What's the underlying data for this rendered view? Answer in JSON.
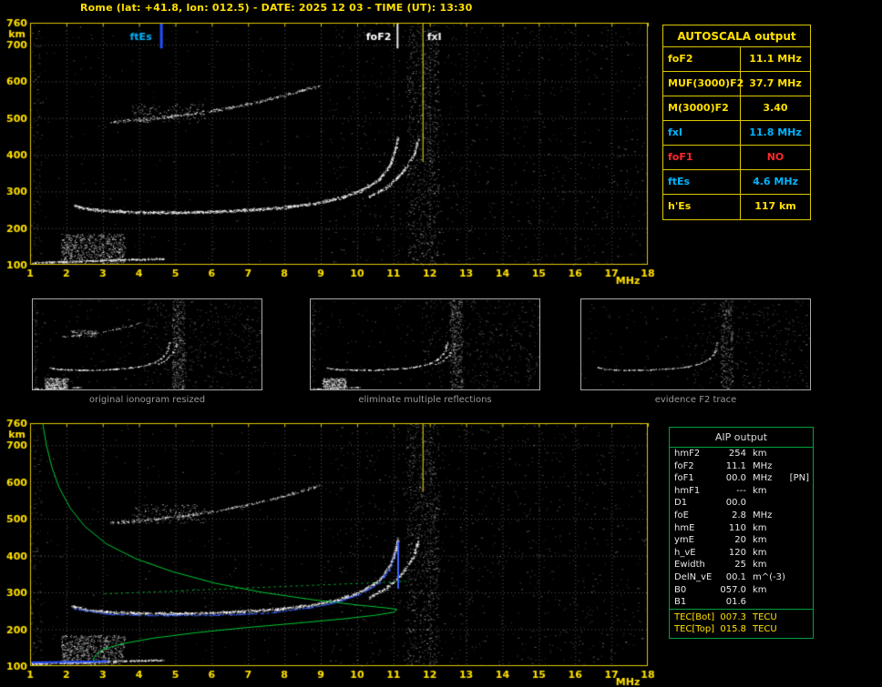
{
  "header": {
    "title": "Rome (lat: +41.8, lon: 012.5) - DATE: 2025 12 03 - TIME (UT): 13:30"
  },
  "autoscala_table": {
    "title": "AUTOSCALA output",
    "rows": [
      {
        "label": "foF2",
        "value": "11.1 MHz",
        "color": "#ffe000"
      },
      {
        "label": "MUF(3000)F2",
        "value": "37.7 MHz",
        "color": "#ffe000"
      },
      {
        "label": "M(3000)F2",
        "value": "3.40",
        "color": "#ffe000"
      },
      {
        "label": "fxI",
        "value": "11.8 MHz",
        "color": "#00b4ff"
      },
      {
        "label": "foF1",
        "value": "NO",
        "color": "#ff2828"
      },
      {
        "label": "ftEs",
        "value": "4.6 MHz",
        "color": "#00b4ff"
      },
      {
        "label": "h'Es",
        "value": "117  km",
        "color": "#ffe000"
      }
    ]
  },
  "aip_table": {
    "title": "AIP output",
    "rows": [
      {
        "label": "hmF2",
        "value": "254",
        "unit": "km",
        "note": ""
      },
      {
        "label": "foF2",
        "value": "11.1",
        "unit": "MHz",
        "note": ""
      },
      {
        "label": "foF1",
        "value": "00.0",
        "unit": "MHz",
        "note": "[PN]"
      },
      {
        "label": "hmF1",
        "value": "---",
        "unit": "km",
        "note": ""
      },
      {
        "label": "D1",
        "value": "00.0",
        "unit": "",
        "note": ""
      },
      {
        "label": "foE",
        "value": "2.8",
        "unit": "MHz",
        "note": ""
      },
      {
        "label": "hmE",
        "value": "110",
        "unit": "km",
        "note": ""
      },
      {
        "label": "ymE",
        "value": "20",
        "unit": "km",
        "note": ""
      },
      {
        "label": "h_vE",
        "value": "120",
        "unit": "km",
        "note": ""
      },
      {
        "label": "Ewidth",
        "value": "25",
        "unit": "km",
        "note": ""
      },
      {
        "label": "DelN_vE",
        "value": "00.1",
        "unit": "m^(-3)",
        "note": ""
      },
      {
        "label": "B0",
        "value": "057.0",
        "unit": "km",
        "note": ""
      },
      {
        "label": "B1",
        "value": "01.6",
        "unit": "",
        "note": ""
      }
    ],
    "tec_rows": [
      {
        "label": "TEC[Bot]",
        "value": "007.3",
        "unit": "TECU",
        "note": ""
      },
      {
        "label": "TEC[Top]",
        "value": "015.8",
        "unit": "TECU",
        "note": ""
      }
    ]
  },
  "thumbnails": [
    {
      "caption": "original ionogram resized"
    },
    {
      "caption": "eliminate multiple reflections"
    },
    {
      "caption": "evidence F2 trace"
    }
  ],
  "chart_data": {
    "type": "scatter",
    "title": "",
    "xlabel": "MHz",
    "ylabel": "km",
    "xlim": [
      1,
      18
    ],
    "ylim": [
      100,
      760
    ],
    "xticks": [
      1,
      2,
      3,
      4,
      5,
      6,
      7,
      8,
      9,
      10,
      11,
      12,
      13,
      14,
      15,
      16,
      17,
      18
    ],
    "yticks": [
      100,
      200,
      300,
      400,
      500,
      600,
      700,
      760
    ],
    "grid": true,
    "scaled_parameters": {
      "foF2_MHz": 11.1,
      "fxI_MHz": 11.8,
      "ftEs_MHz": 4.6,
      "hEs_km": 117,
      "hmF2_km": 254,
      "foE_MHz": 2.8,
      "hmE_km": 110
    },
    "layers": {
      "es_layer": {
        "kind": "trace",
        "color": "#ffffff",
        "points": [
          [
            1.05,
            106
          ],
          [
            2.2,
            110
          ],
          [
            3.5,
            114
          ],
          [
            4.65,
            117
          ]
        ],
        "spread": 3,
        "density": 2.2
      },
      "e_region_scatter": {
        "kind": "blob",
        "color": "#ffffff",
        "x": [
          1.85,
          3.6
        ],
        "y": [
          102,
          185
        ],
        "count": 650,
        "alpha": 0.8
      },
      "f2_trace": {
        "kind": "trace",
        "color": "#ffffff",
        "points": [
          [
            2.15,
            263
          ],
          [
            2.6,
            252
          ],
          [
            3.2,
            247
          ],
          [
            4,
            244
          ],
          [
            5,
            243
          ],
          [
            6,
            245
          ],
          [
            7,
            250
          ],
          [
            8,
            257
          ],
          [
            8.8,
            267
          ],
          [
            9.5,
            282
          ],
          [
            10.1,
            303
          ],
          [
            10.6,
            333
          ],
          [
            10.9,
            373
          ],
          [
            11.05,
            415
          ],
          [
            11.12,
            448
          ]
        ],
        "spread": 5,
        "density": 3
      },
      "f2_x_trace": {
        "kind": "trace",
        "color": "#ffffff",
        "points": [
          [
            10.3,
            285
          ],
          [
            10.8,
            312
          ],
          [
            11.2,
            348
          ],
          [
            11.55,
            398
          ],
          [
            11.68,
            445
          ]
        ],
        "spread": 5,
        "density": 2.4
      },
      "second_hop": {
        "kind": "trace",
        "color": "#e8e8e8",
        "points": [
          [
            3.2,
            490
          ],
          [
            4.2,
            497
          ],
          [
            5.2,
            508
          ],
          [
            6.2,
            523
          ],
          [
            7.2,
            543
          ],
          [
            8.2,
            568
          ],
          [
            9.0,
            592
          ]
        ],
        "spread": 5,
        "density": 1.4
      },
      "second_hop_scatter": {
        "kind": "blob",
        "color": "#ffffff",
        "x": [
          3.8,
          5.8
        ],
        "y": [
          488,
          540
        ],
        "count": 150,
        "alpha": 0.7
      },
      "noise_sparse": {
        "kind": "blob",
        "color": "#c8c8c8",
        "x": [
          1,
          18
        ],
        "y": [
          100,
          758
        ],
        "count": 420,
        "alpha": 0.45
      },
      "noise_right": {
        "kind": "blob",
        "color": "#d0d0d0",
        "x": [
          9.2,
          17.95
        ],
        "y": [
          100,
          758
        ],
        "count": 850,
        "alpha": 0.5
      },
      "noise_column": {
        "kind": "blob",
        "color": "#e0e0e0",
        "x": [
          11.35,
          12.25
        ],
        "y": [
          100,
          758
        ],
        "count": 780,
        "alpha": 0.62
      },
      "noise_left_edge": {
        "kind": "blob",
        "color": "#c0c0c0",
        "x": [
          1.0,
          1.3
        ],
        "y": [
          100,
          758
        ],
        "count": 130,
        "alpha": 0.5
      },
      "profile_green": {
        "kind": "line",
        "color": "#00c832",
        "lw": 1,
        "points": [
          [
            1.35,
            758
          ],
          [
            1.45,
            700
          ],
          [
            1.6,
            640
          ],
          [
            1.8,
            585
          ],
          [
            2.1,
            530
          ],
          [
            2.5,
            480
          ],
          [
            3.1,
            432
          ],
          [
            3.9,
            392
          ],
          [
            4.9,
            357
          ],
          [
            6.1,
            325
          ],
          [
            7.4,
            300
          ],
          [
            8.8,
            280
          ],
          [
            10.0,
            266
          ],
          [
            10.8,
            258
          ],
          [
            11.1,
            254
          ],
          [
            11.0,
            246
          ],
          [
            10.5,
            238
          ],
          [
            9.6,
            228
          ],
          [
            8.4,
            217
          ],
          [
            7.0,
            205
          ],
          [
            5.6,
            191
          ],
          [
            4.4,
            176
          ],
          [
            3.5,
            160
          ],
          [
            3.0,
            145
          ],
          [
            2.8,
            130
          ],
          [
            2.75,
            118
          ],
          [
            2.8,
            108
          ]
        ]
      },
      "profile_dotted": {
        "kind": "line",
        "color": "#00c832",
        "lw": 1,
        "dash": [
          2,
          4
        ],
        "points": [
          [
            3.05,
            296
          ],
          [
            11.35,
            330
          ]
        ]
      },
      "restored_trace_blue": {
        "kind": "trace",
        "color": "#3c64ff",
        "points": [
          [
            2.2,
            256
          ],
          [
            3.2,
            241
          ],
          [
            4.5,
            238
          ],
          [
            6,
            239
          ],
          [
            7.5,
            244
          ],
          [
            8.8,
            261
          ],
          [
            9.5,
            276
          ],
          [
            10.1,
            297
          ],
          [
            10.6,
            327
          ],
          [
            10.9,
            367
          ],
          [
            11.05,
            409
          ]
        ],
        "spread": 2,
        "density": 1.6
      },
      "restored_e_blue": {
        "kind": "line",
        "color": "#2850ff",
        "lw": 2,
        "points": [
          [
            1.02,
            110
          ],
          [
            3.15,
            113
          ]
        ]
      },
      "asymptote_blue": {
        "kind": "line",
        "color": "#3c64ff",
        "lw": 2,
        "points": [
          [
            11.13,
            310
          ],
          [
            11.13,
            438
          ]
        ]
      }
    },
    "views": {
      "main": {
        "canvas": "iono-main",
        "axes": true,
        "seed": 7,
        "layers": [
          "noise_sparse",
          "noise_right",
          "noise_column",
          "noise_left_edge",
          "e_region_scatter",
          "es_layer",
          "second_hop",
          "second_hop_scatter",
          "f2_trace",
          "f2_x_trace"
        ],
        "markers": [
          {
            "x": 4.6,
            "line_color": "#1e50ff",
            "lw": 3,
            "y_bottom": 690,
            "label": "ftEs",
            "label_color": "#00b4ff",
            "label_dx": -34
          },
          {
            "x": 11.1,
            "line_color": "#e8e8e8",
            "lw": 2,
            "y_bottom": 690,
            "label": "foF2",
            "label_color": "#ffffff",
            "label_dx": -34
          },
          {
            "x": 11.8,
            "line_color": "#ffe000",
            "lw": 1,
            "y_bottom": 380,
            "label": "fxI",
            "label_color": "#f0f0f0",
            "label_dx": 5
          }
        ]
      },
      "profile": {
        "canvas": "iono-profile",
        "axes": true,
        "seed": 11,
        "layers": [
          "noise_sparse",
          "noise_right",
          "noise_column",
          "noise_left_edge",
          "e_region_scatter",
          "es_layer",
          "second_hop",
          "second_hop_scatter",
          "f2_trace",
          "f2_x_trace",
          "profile_dotted",
          "profile_green",
          "restored_e_blue",
          "restored_trace_blue",
          "asymptote_blue"
        ],
        "markers": [
          {
            "x": 11.8,
            "line_color": "#ffe000",
            "lw": 1,
            "y_bottom": 575
          }
        ]
      },
      "thumb1": {
        "canvas": "thumb-1",
        "axes": false,
        "seed": 3,
        "density_scale": 0.45,
        "layers": [
          "noise_sparse",
          "noise_right",
          "noise_column",
          "noise_left_edge",
          "e_region_scatter",
          "es_layer",
          "second_hop",
          "second_hop_scatter",
          "f2_trace",
          "f2_x_trace"
        ]
      },
      "thumb2": {
        "canvas": "thumb-2",
        "axes": false,
        "seed": 4,
        "density_scale": 0.45,
        "layers": [
          "noise_sparse",
          "noise_right",
          "noise_column",
          "noise_left_edge",
          "e_region_scatter",
          "es_layer",
          "f2_trace",
          "f2_x_trace"
        ]
      },
      "thumb3": {
        "canvas": "thumb-3",
        "axes": false,
        "seed": 5,
        "density_scale": 0.35,
        "layers": [
          "noise_sparse",
          "noise_column",
          "noise_right",
          "f2_trace"
        ]
      }
    }
  }
}
